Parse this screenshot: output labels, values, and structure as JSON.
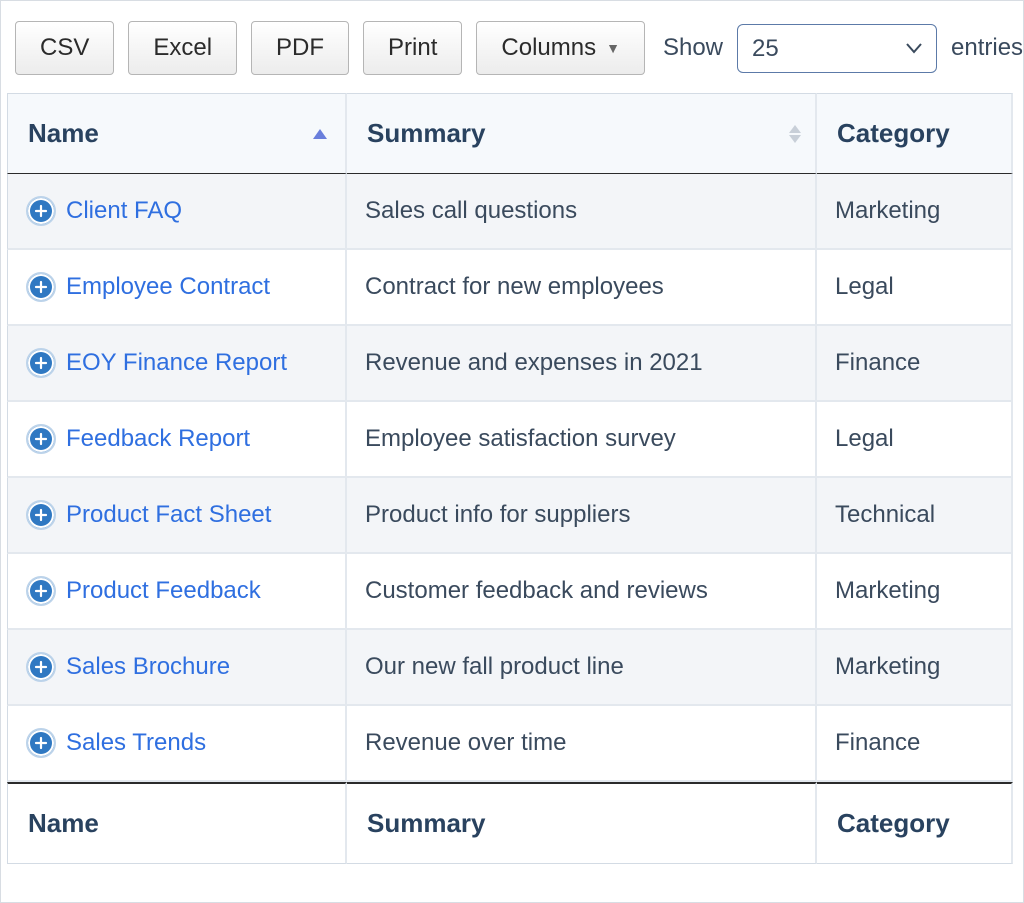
{
  "toolbar": {
    "csv": "CSV",
    "excel": "Excel",
    "pdf": "PDF",
    "print": "Print",
    "columns": "Columns",
    "show_label": "Show",
    "entries_label": "entries",
    "page_size": "25"
  },
  "columns": {
    "name": "Name",
    "summary": "Summary",
    "category": "Category"
  },
  "footer": {
    "name": "Name",
    "summary": "Summary",
    "category": "Category"
  },
  "rows": [
    {
      "name": "Client FAQ",
      "summary": "Sales call questions",
      "category": "Marketing"
    },
    {
      "name": "Employee Contract",
      "summary": "Contract for new employees",
      "category": "Legal"
    },
    {
      "name": "EOY Finance Report",
      "summary": "Revenue and expenses in 2021",
      "category": "Finance"
    },
    {
      "name": "Feedback Report",
      "summary": "Employee satisfaction survey",
      "category": "Legal"
    },
    {
      "name": "Product Fact Sheet",
      "summary": "Product info for suppliers",
      "category": "Technical"
    },
    {
      "name": "Product Feedback",
      "summary": "Customer feedback and reviews",
      "category": "Marketing"
    },
    {
      "name": "Sales Brochure",
      "summary": "Our new fall product line",
      "category": "Marketing"
    },
    {
      "name": "Sales Trends",
      "summary": "Revenue over time",
      "category": "Finance"
    }
  ]
}
